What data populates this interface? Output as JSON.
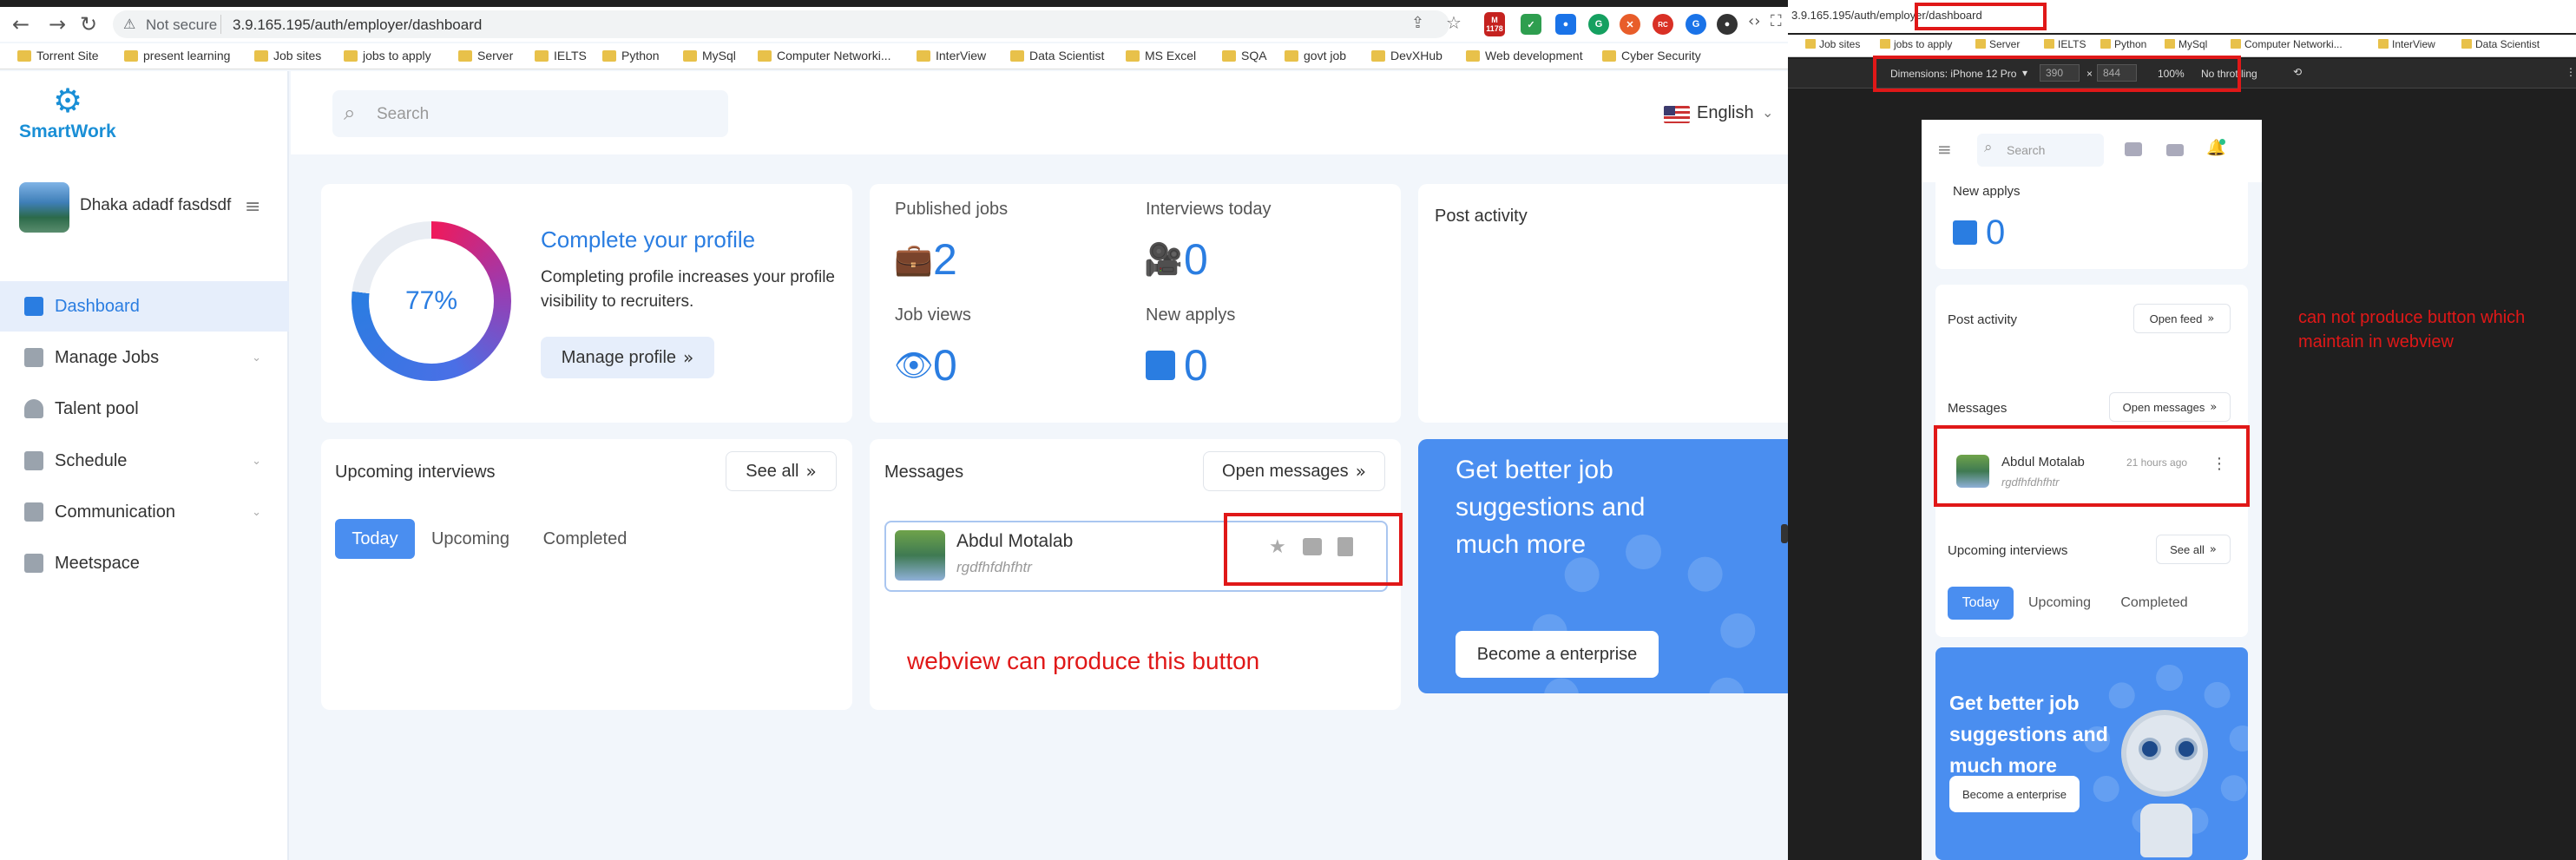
{
  "left_browser": {
    "url_prefix": "Not secure",
    "url": "3.9.165.195/auth/employer/dashboard",
    "ext_badge": "1178",
    "bookmarks": [
      "Torrent Site",
      "present learning",
      "Job sites",
      "jobs to apply",
      "Server",
      "IELTS",
      "Python",
      "MySql",
      "Computer Networki...",
      "InterView",
      "Data Scientist",
      "MS Excel",
      "SQA",
      "govt job",
      "DevXHub",
      "Web development",
      "Cyber Security"
    ]
  },
  "sidebar": {
    "brand": "SmartWork",
    "user_name": "Dhaka adadf fasdsdf",
    "items": [
      {
        "label": "Dashboard",
        "active": true
      },
      {
        "label": "Manage Jobs",
        "has_chevron": true
      },
      {
        "label": "Talent pool"
      },
      {
        "label": "Schedule",
        "has_chevron": true
      },
      {
        "label": "Communication",
        "has_chevron": true
      },
      {
        "label": "Meetspace"
      }
    ]
  },
  "topbar": {
    "search_placeholder": "Search",
    "language": "English"
  },
  "profile_card": {
    "percent_label": "77%",
    "progress_fraction": 0.77,
    "title": "Complete your profile",
    "description": "Completing profile increases your profile visibility to recruiters.",
    "button": "Manage profile"
  },
  "stats": {
    "published_jobs": {
      "label": "Published jobs",
      "value": "2"
    },
    "interviews_today": {
      "label": "Interviews today",
      "value": "0"
    },
    "job_views": {
      "label": "Job views",
      "value": "0"
    },
    "new_applys": {
      "label": "New applys",
      "value": "0"
    }
  },
  "post_activity": {
    "title": "Post activity"
  },
  "upcoming": {
    "title": "Upcoming interviews",
    "see_all": "See all",
    "tabs": [
      "Today",
      "Upcoming",
      "Completed"
    ]
  },
  "messages": {
    "title": "Messages",
    "open_button": "Open messages",
    "item": {
      "name": "Abdul Motalab",
      "preview": "rgdfhfdhfhtr",
      "time": "21 hours ago"
    }
  },
  "promo": {
    "text_left": "Get better job suggestions and much more",
    "text_right": "Get better job suggestions and much more",
    "button": "Become a enterprise"
  },
  "annotations": {
    "left_note": "webview can produce this button",
    "right_note": "can not produce button which maintain in webview"
  },
  "right_browser": {
    "url": "3.9.165.195/auth/employer/dashboard",
    "bookmarks": [
      "Job sites",
      "jobs to apply",
      "Server",
      "IELTS",
      "Python",
      "MySql",
      "Computer Networki...",
      "InterView",
      "Data Scientist"
    ],
    "dimensions_label": "Dimensions: iPhone 12 Pro",
    "width": "390",
    "height": "844",
    "zoom": "100%",
    "throttling": "No throttling"
  },
  "mobile": {
    "search_placeholder": "Search",
    "new_applys_label": "New applys",
    "new_applys_value": "0",
    "post_activity": "Post activity",
    "open_feed": "Open feed",
    "messages": "Messages",
    "open_messages": "Open messages",
    "msg_name": "Abdul Motalab",
    "msg_time": "21 hours ago",
    "msg_preview": "rgdfhfdhfhtr",
    "upcoming": "Upcoming interviews",
    "see_all": "See all",
    "tabs": [
      "Today",
      "Upcoming",
      "Completed"
    ],
    "promo_text": "Get better job suggestions and much more",
    "promo_button": "Become a enterprise"
  },
  "colors": {
    "accent": "#2a7de1",
    "annotation": "#e01818",
    "promo": "#4a8ef0"
  }
}
